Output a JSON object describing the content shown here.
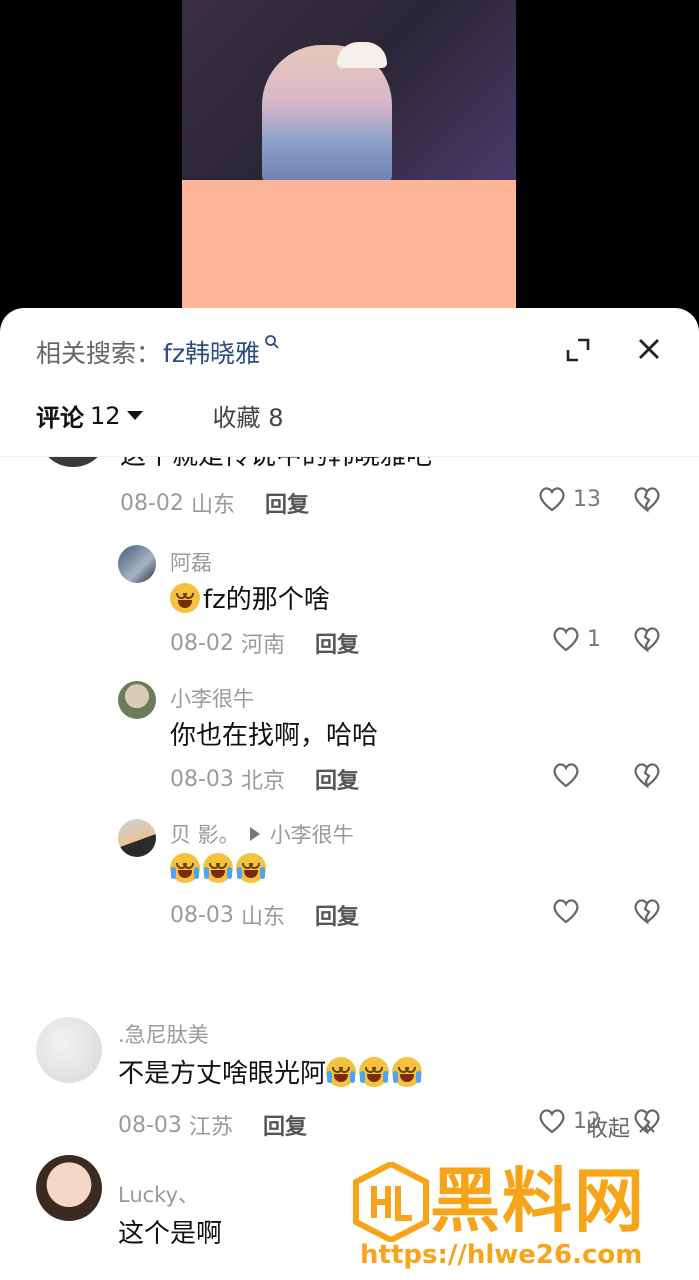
{
  "related": {
    "label": "相关搜索：",
    "keyword": "fz韩晓雅"
  },
  "tabs": {
    "comments_label": "评论",
    "comments_count": "12",
    "favorites_label": "收藏",
    "favorites_count": "8"
  },
  "comments": [
    {
      "partial_text": "这个就是传说中的韩晓雅吧",
      "date": "08-02",
      "region": "山东",
      "reply": "回复",
      "likes": "13"
    },
    {
      "user": "阿磊",
      "text": "fz的那个啥",
      "date": "08-02",
      "region": "河南",
      "reply": "回复",
      "likes": "1"
    },
    {
      "user": "小李很牛",
      "text": "你也在找啊，哈哈",
      "date": "08-03",
      "region": "北京",
      "reply": "回复",
      "likes": ""
    },
    {
      "user": "贝 影。",
      "reply_to": "小李很牛",
      "text": "",
      "date": "08-03",
      "region": "山东",
      "reply": "回复",
      "likes": ""
    },
    {
      "user": ".急尼肽美",
      "text": "不是方丈啥眼光阿",
      "date": "08-03",
      "region": "江苏",
      "reply": "回复",
      "likes": "12"
    },
    {
      "user": "Lucky、",
      "text": "这个是啊"
    }
  ],
  "collapse_label": "收起",
  "watermark": {
    "title": "黑料网",
    "url": "https://hlwe26.com"
  },
  "colors": {
    "accent_link": "#2b4c7e",
    "watermark": "#f7a418",
    "cover": "#ffb597"
  }
}
